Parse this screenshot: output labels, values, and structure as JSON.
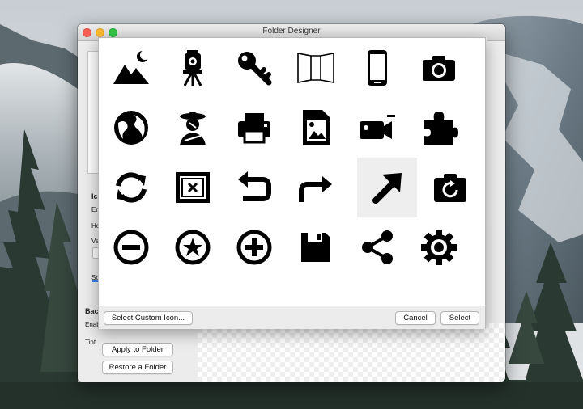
{
  "window": {
    "title": "Folder Designer"
  },
  "left_panel": {
    "ic": "Ic",
    "en": "En",
    "ho": "Ho",
    "ve": "Ve",
    "sc": "Sc",
    "bac": "Bac",
    "enab": "Enab",
    "tint": "Tint"
  },
  "buttons": {
    "apply": "Apply to Folder",
    "restore": "Restore a Folder"
  },
  "sheet": {
    "custom_icon": "Select Custom Icon...",
    "cancel": "Cancel",
    "select": "Select"
  },
  "icons": [
    "mountain-moon-icon",
    "surveyor-transit-icon",
    "key-icon",
    "panorama-icon",
    "smartphone-icon",
    "camera-icon",
    "globe-icon",
    "woman-with-hat-icon",
    "printer-icon",
    "image-file-icon",
    "video-camera-icon",
    "puzzle-piece-icon",
    "sync-icon",
    "framed-picture-icon",
    "undo-arrow-icon",
    "redo-arrow-icon",
    "arrow-up-right-icon",
    "camera-rotate-icon",
    "minus-circle-icon",
    "star-circle-icon",
    "plus-circle-icon",
    "floppy-disk-icon",
    "share-icon",
    "cog-icon"
  ],
  "selected_icon": "arrow-up-right-icon"
}
